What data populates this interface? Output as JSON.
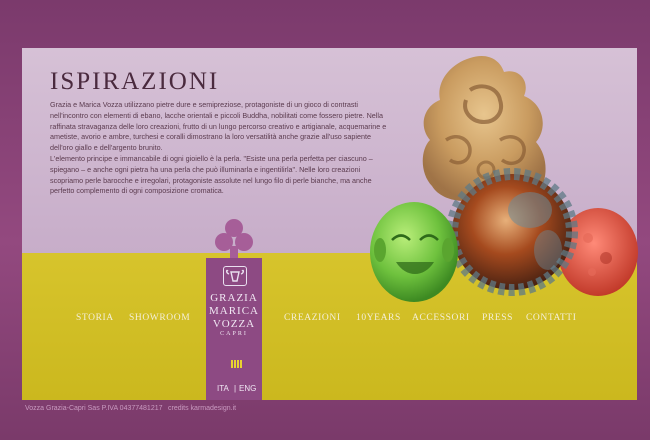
{
  "colors": {
    "background": "#8a3f77",
    "panel_top": "#cdb5cf",
    "panel_bottom": "#d4c02a",
    "title": "#4a2a3e",
    "text": "#5b3b4e",
    "nav_text": "#f4efd8",
    "logo_bg": "#8d4a83",
    "footer_text": "#c99ac0"
  },
  "page": {
    "title": "ISPIRAZIONI",
    "paragraphs": [
      "Grazia e Marica Vozza utilizzano pietre dure e semipreziose, protagoniste di un gioco di contrasti nell'incontro con elementi di ebano, lacche orientali e piccoli Buddha, nobilitati come fossero pietre. Nella raffinata stravaganza delle loro creazioni, frutto di un lungo percorso creativo e artigianale, acquemarine e ametiste, avorio e ambre, turchesi e coralli dimostrano la loro versatilità anche grazie all'uso sapiente dell'oro giallo e dell'argento brunito.",
      "L'elemento principe e immancabile di ogni gioiello è la perla. \"Esiste una perla perfetta per ciascuno – spiegano – e anche ogni pietra ha una perla che può illuminarla e ingentilirla\". Nelle loro creazioni scopriamo perle barocche e irregolari, protagoniste assolute nel lungo filo di perle bianche, ma anche perfetto complemento di ogni composizione cromatica."
    ]
  },
  "nav": {
    "left": [
      "STORIA",
      "SHOWROOM"
    ],
    "right": [
      "CREAZIONI",
      "10YEARS",
      "ACCESSORI",
      "PRESS",
      "CONTATTI"
    ]
  },
  "logo": {
    "lines": [
      "GRAZIA",
      "MARICA",
      "VOZZA",
      "CAPRI"
    ]
  },
  "language": {
    "ita": "ITA",
    "separator": "|",
    "eng": "ENG"
  },
  "footer": {
    "company": "Vozza Grazia-Capri Sas P.IVA 04377481217",
    "credits": "credits karmadesign.it"
  },
  "icons": [
    "trefoil-ornament-icon",
    "ram-head-logo-icon",
    "vertical-bars-icon"
  ]
}
